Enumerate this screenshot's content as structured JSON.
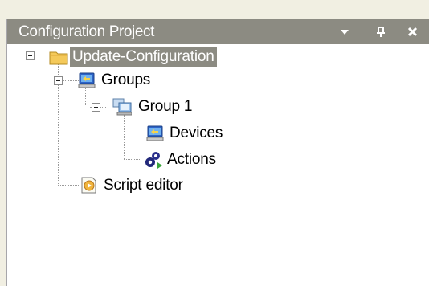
{
  "panel": {
    "title": "Configuration Project",
    "buttons": {
      "dropdown": "dropdown-arrow-icon",
      "pin": "pin-icon",
      "close": "close-icon"
    }
  },
  "tree": {
    "root": {
      "label": "Update-Configuration",
      "icon": "folder-icon",
      "selected": true
    },
    "groups": {
      "label": "Groups",
      "icon": "groups-icon"
    },
    "group1": {
      "label": "Group 1",
      "icon": "group-computers-icon"
    },
    "devices": {
      "label": "Devices",
      "icon": "devices-icon"
    },
    "actions": {
      "label": "Actions",
      "icon": "actions-gears-icon"
    },
    "script": {
      "label": "Script editor",
      "icon": "script-editor-icon"
    }
  },
  "colors": {
    "titlebar": "#8c8b82",
    "selection": "#8c8b82",
    "frame": "#f1efe2"
  }
}
